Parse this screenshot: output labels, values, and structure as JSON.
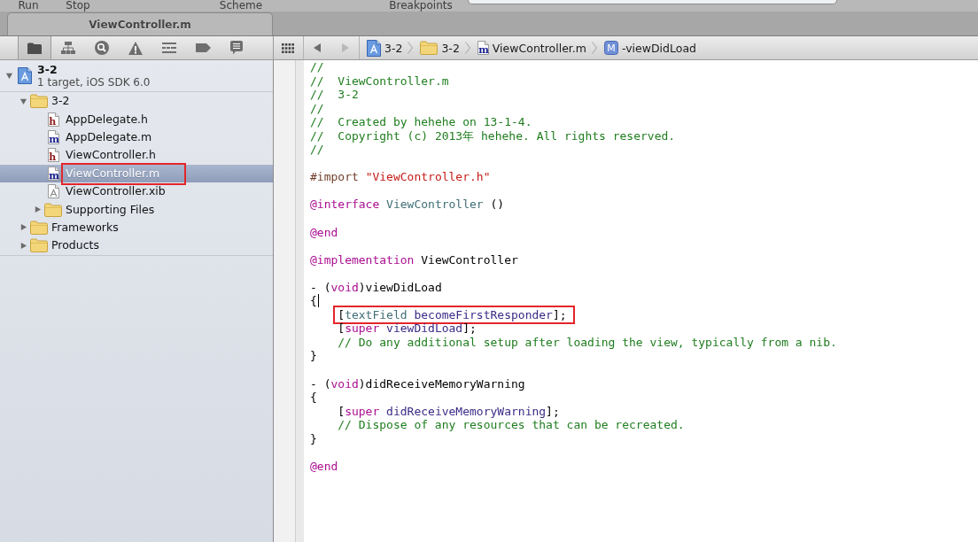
{
  "toolbar": {
    "labels": [
      "Run",
      "Stop",
      "Scheme",
      "Breakpoints"
    ]
  },
  "tabs": [
    {
      "label": "ViewController.m",
      "selected": true
    }
  ],
  "navigator": {
    "tabs": [
      {
        "kind": "project",
        "selected": true
      },
      {
        "kind": "symbol",
        "selected": false
      },
      {
        "kind": "search",
        "selected": false
      },
      {
        "kind": "issue",
        "selected": false
      },
      {
        "kind": "debug",
        "selected": false
      },
      {
        "kind": "breakpoint",
        "selected": false
      },
      {
        "kind": "log",
        "selected": false
      }
    ],
    "tree": [
      {
        "kind": "project",
        "label": "3-2",
        "subtitle": "1 target, iOS SDK 6.0",
        "expanded": true,
        "selected": false,
        "annotated": false,
        "children": [
          {
            "kind": "group",
            "label": "3-2",
            "expanded": true,
            "selected": false,
            "annotated": false,
            "children": [
              {
                "kind": "header",
                "icon_text": "h",
                "label": "AppDelegate.h",
                "selected": false,
                "annotated": false
              },
              {
                "kind": "source",
                "icon_text": "m",
                "label": "AppDelegate.m",
                "selected": false,
                "annotated": false
              },
              {
                "kind": "header",
                "icon_text": "h",
                "label": "ViewController.h",
                "selected": false,
                "annotated": false
              },
              {
                "kind": "source",
                "icon_text": "m",
                "label": "ViewController.m",
                "selected": true,
                "annotated": true
              },
              {
                "kind": "interface",
                "label": "ViewController.xib",
                "selected": false,
                "annotated": false
              },
              {
                "kind": "group",
                "label": "Supporting Files",
                "expanded": false,
                "selected": false,
                "annotated": false
              }
            ]
          },
          {
            "kind": "group",
            "label": "Frameworks",
            "expanded": false,
            "selected": false,
            "annotated": false
          },
          {
            "kind": "group",
            "label": "Products",
            "expanded": false,
            "selected": false,
            "annotated": false
          }
        ]
      }
    ]
  },
  "jump_bar": {
    "back": {
      "disabled": false
    },
    "forward": {
      "disabled": true
    },
    "path": [
      {
        "kind": "project",
        "label": "3-2"
      },
      {
        "kind": "group",
        "label": "3-2"
      },
      {
        "kind": "source",
        "icon_text": "m",
        "label": "ViewController.m"
      },
      {
        "kind": "method",
        "icon_text": "M",
        "label": "-viewDidLoad"
      }
    ]
  },
  "editor": {
    "blocks": [
      [
        {
          "tokens": [
            {
              "kind": "comment",
              "text": "//"
            }
          ],
          "annotated": false
        },
        {
          "tokens": [
            {
              "kind": "comment",
              "text": "//  ViewController.m"
            }
          ],
          "annotated": false
        },
        {
          "tokens": [
            {
              "kind": "comment",
              "text": "//  3-2"
            }
          ],
          "annotated": false
        },
        {
          "tokens": [
            {
              "kind": "comment",
              "text": "//"
            }
          ],
          "annotated": false
        },
        {
          "tokens": [
            {
              "kind": "comment",
              "text": "//  Created by hehehe on 13-1-4."
            }
          ],
          "annotated": false
        },
        {
          "tokens": [
            {
              "kind": "comment",
              "text": "//  Copyright (c) 2013年 hehehe. All rights reserved."
            }
          ],
          "annotated": false
        },
        {
          "tokens": [
            {
              "kind": "comment",
              "text": "//"
            }
          ],
          "annotated": false
        }
      ],
      [
        {
          "tokens": [
            {
              "kind": "preprocessor",
              "text": "#import "
            },
            {
              "kind": "string",
              "text": "\"ViewController.h\""
            }
          ],
          "annotated": false
        }
      ],
      [
        {
          "tokens": [
            {
              "kind": "keyword",
              "text": "@interface"
            },
            {
              "kind": "class",
              "text": " ViewController"
            },
            {
              "kind": "plain",
              "text": " ()"
            }
          ],
          "annotated": false
        }
      ],
      [
        {
          "tokens": [
            {
              "kind": "keyword",
              "text": "@end"
            }
          ],
          "annotated": false
        }
      ],
      [
        {
          "tokens": [
            {
              "kind": "keyword",
              "text": "@implementation"
            },
            {
              "kind": "plain",
              "text": " ViewController"
            }
          ],
          "annotated": false
        }
      ],
      [
        {
          "tokens": [
            {
              "kind": "plain",
              "text": "- ("
            },
            {
              "kind": "keyword",
              "text": "void"
            },
            {
              "kind": "plain",
              "text": ")viewDidLoad"
            }
          ],
          "annotated": false
        },
        {
          "tokens": [
            {
              "kind": "plain",
              "text": "{"
            },
            {
              "kind": "cursor"
            }
          ],
          "annotated": false,
          "children": [
            {
              "tokens": [
                {
                  "kind": "plain",
                  "text": "["
                },
                {
                  "kind": "variable",
                  "text": "textField"
                },
                {
                  "kind": "method",
                  "text": " becomeFirstResponder"
                },
                {
                  "kind": "plain",
                  "text": "];"
                }
              ],
              "annotated": true
            },
            {
              "tokens": [
                {
                  "kind": "plain",
                  "text": "["
                },
                {
                  "kind": "keyword",
                  "text": "super"
                },
                {
                  "kind": "method",
                  "text": " viewDidLoad"
                },
                {
                  "kind": "plain",
                  "text": "];"
                }
              ],
              "annotated": false
            },
            {
              "tokens": [
                {
                  "kind": "comment",
                  "text": "// Do any additional setup after loading the view, typically from a nib."
                }
              ],
              "annotated": false
            }
          ]
        },
        {
          "tokens": [
            {
              "kind": "plain",
              "text": "}"
            }
          ],
          "annotated": false
        }
      ],
      [
        {
          "tokens": [
            {
              "kind": "plain",
              "text": "- ("
            },
            {
              "kind": "keyword",
              "text": "void"
            },
            {
              "kind": "plain",
              "text": ")didReceiveMemoryWarning"
            }
          ],
          "annotated": false
        },
        {
          "tokens": [
            {
              "kind": "plain",
              "text": "{"
            }
          ],
          "annotated": false,
          "children": [
            {
              "tokens": [
                {
                  "kind": "plain",
                  "text": "["
                },
                {
                  "kind": "keyword",
                  "text": "super"
                },
                {
                  "kind": "method",
                  "text": " didReceiveMemoryWarning"
                },
                {
                  "kind": "plain",
                  "text": "];"
                }
              ],
              "annotated": false
            },
            {
              "tokens": [
                {
                  "kind": "comment",
                  "text": "// Dispose of any resources that can be recreated."
                }
              ],
              "annotated": false
            }
          ]
        },
        {
          "tokens": [
            {
              "kind": "plain",
              "text": "}"
            }
          ],
          "annotated": false
        }
      ],
      [
        {
          "tokens": [
            {
              "kind": "keyword",
              "text": "@end"
            }
          ],
          "annotated": false
        }
      ]
    ]
  }
}
